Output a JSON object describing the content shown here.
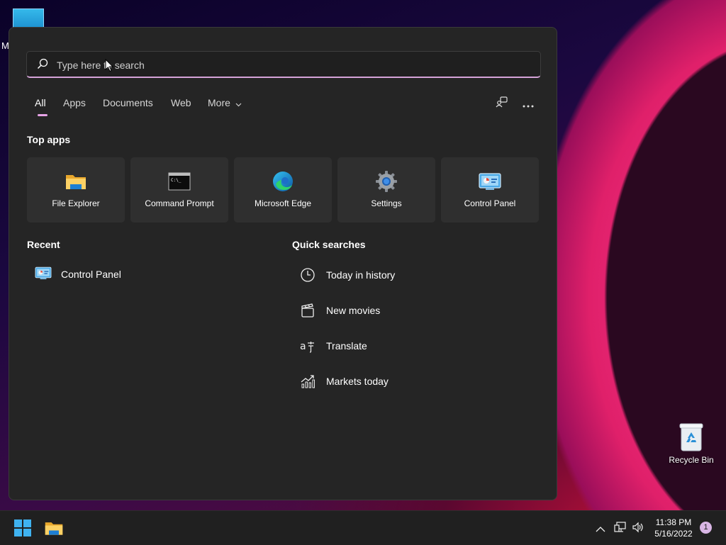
{
  "desktop": {
    "partial_label": "M",
    "recycle_bin_label": "Recycle Bin"
  },
  "search": {
    "placeholder": "Type here to search",
    "value": ""
  },
  "tabs": [
    {
      "label": "All",
      "active": true
    },
    {
      "label": "Apps"
    },
    {
      "label": "Documents"
    },
    {
      "label": "Web"
    },
    {
      "label": "More"
    }
  ],
  "top_apps": {
    "title": "Top apps",
    "items": [
      {
        "label": "File Explorer",
        "icon": "folder-icon"
      },
      {
        "label": "Command Prompt",
        "icon": "command-prompt-icon"
      },
      {
        "label": "Microsoft Edge",
        "icon": "edge-icon"
      },
      {
        "label": "Settings",
        "icon": "gear-icon"
      },
      {
        "label": "Control Panel",
        "icon": "control-panel-icon"
      }
    ]
  },
  "recent": {
    "title": "Recent",
    "items": [
      {
        "label": "Control Panel",
        "icon": "control-panel-icon"
      }
    ]
  },
  "quick_searches": {
    "title": "Quick searches",
    "items": [
      {
        "label": "Today in history",
        "icon": "clock-icon"
      },
      {
        "label": "New movies",
        "icon": "clapperboard-icon"
      },
      {
        "label": "Translate",
        "icon": "translate-icon"
      },
      {
        "label": "Markets today",
        "icon": "chart-icon"
      }
    ]
  },
  "taskbar": {
    "time": "11:38 PM",
    "date": "5/16/2022",
    "notification_count": "1"
  },
  "colors": {
    "accent": "#e8a4e8",
    "panel": "#252525",
    "tile": "#2f2f2f",
    "taskbar": "#202020"
  }
}
